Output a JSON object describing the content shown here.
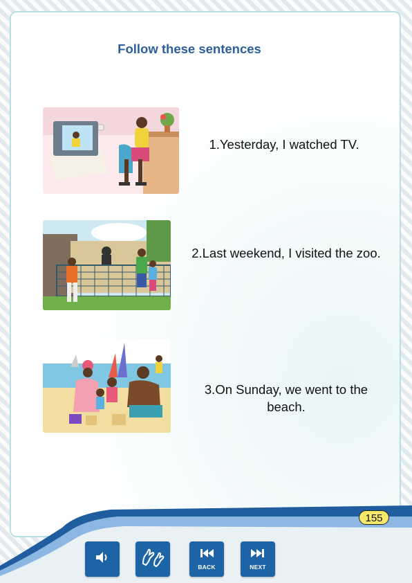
{
  "title": "Follow these sentences",
  "items": [
    {
      "sentence": "1.Yesterday, I watched TV.",
      "image": "boy-watching-tv-illustration"
    },
    {
      "sentence": "2.Last weekend, I visited the zoo.",
      "image": "family-at-zoo-illustration"
    },
    {
      "sentence": "3.On Sunday, we went to the beach.",
      "image": "family-at-beach-illustration"
    }
  ],
  "page_number": "155",
  "nav": {
    "audio_icon": "speaker-icon",
    "sign_icon": "sign-language-icon",
    "back_label": "BACK",
    "next_label": "NEXT"
  },
  "colors": {
    "title": "#2e5f9c",
    "button": "#1c64a6",
    "band_light": "#8db7e3",
    "band_dark": "#1f5d9e",
    "badge": "#f5e86a",
    "card_border": "#b9dfe6"
  }
}
